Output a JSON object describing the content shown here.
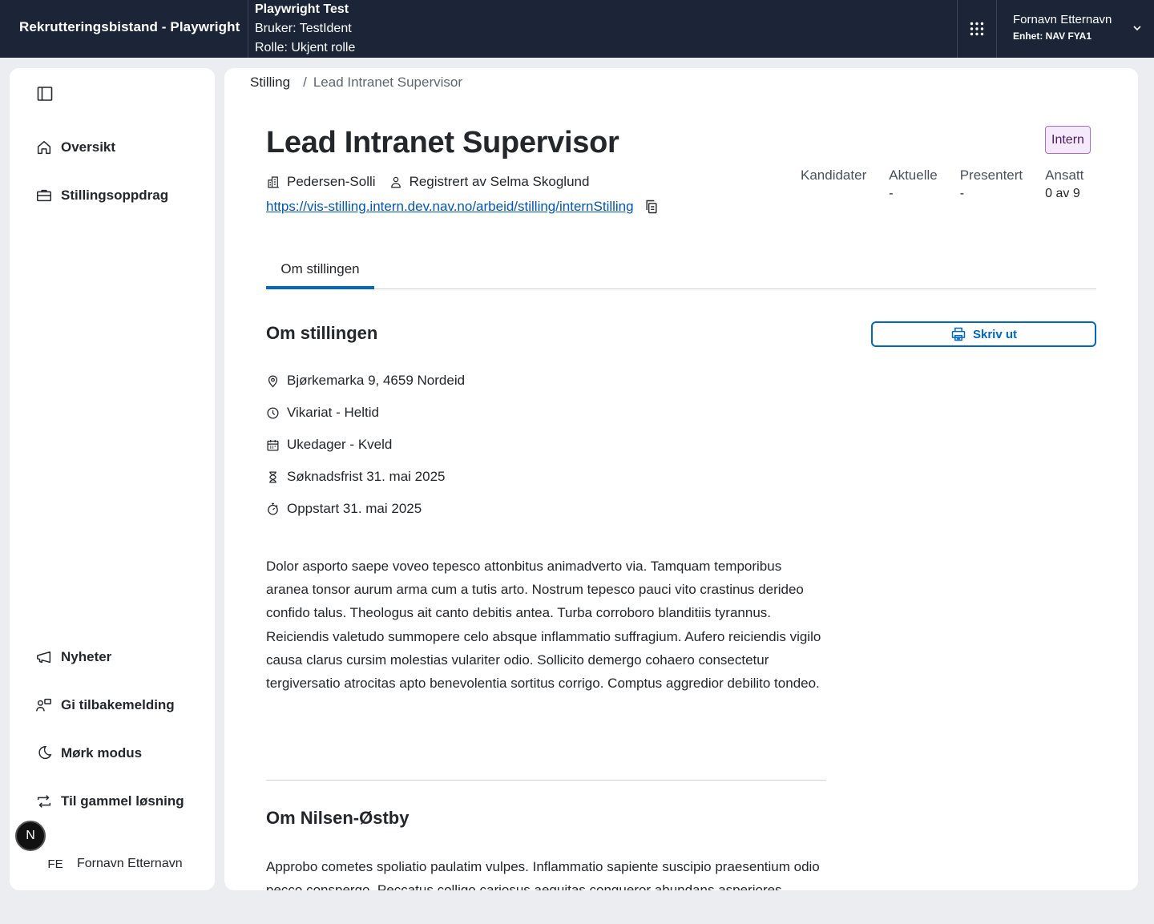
{
  "header": {
    "app_title": "Rekrutteringsbistand - Playwright",
    "env_name": "Playwright Test",
    "env_user": "Bruker: TestIdent",
    "env_role": "Rolle: Ukjent rolle",
    "user_name": "Fornavn Etternavn",
    "user_unit": "Enhet: NAV FYA1"
  },
  "sidebar": {
    "top_items": [
      {
        "label": "Oversikt",
        "icon": "house-icon"
      },
      {
        "label": "Stillingsoppdrag",
        "icon": "briefcase-icon"
      }
    ],
    "bottom_items": [
      {
        "label": "Nyheter",
        "icon": "megaphone-icon"
      },
      {
        "label": "Gi tilbakemelding",
        "icon": "feedback-icon"
      },
      {
        "label": "Mørk modus",
        "icon": "moon-icon"
      },
      {
        "label": "Til gammel løsning",
        "icon": "arrows-circle-icon"
      }
    ],
    "user_initials": "FE",
    "user_name": "Fornavn Etternavn",
    "next_badge": "N"
  },
  "breadcrumb": {
    "root": "Stilling",
    "separator": "/",
    "current": "Lead Intranet Supervisor"
  },
  "job": {
    "title": "Lead Intranet Supervisor",
    "employer": "Pedersen-Solli",
    "registered_by": "Registrert av Selma Skoglund",
    "link": "https://vis-stilling.intern.dev.nav.no/arbeid/stilling/internStilling",
    "visibility_badge": "Intern"
  },
  "stats": [
    {
      "label": "Kandidater",
      "value": ""
    },
    {
      "label": "Aktuelle",
      "value": "-"
    },
    {
      "label": "Presentert",
      "value": "-"
    },
    {
      "label": "Ansatt",
      "value": "0 av 9"
    }
  ],
  "tabs": [
    {
      "label": "Om stillingen",
      "active": true
    }
  ],
  "about": {
    "title": "Om stillingen",
    "print_label": "Skriv ut",
    "facts": [
      {
        "icon": "location-pin-icon",
        "text": "Bjørkemarka 9, 4659 Nordeid"
      },
      {
        "icon": "clock-icon",
        "text": "Vikariat - Heltid"
      },
      {
        "icon": "calendar-icon",
        "text": "Ukedager - Kveld"
      },
      {
        "icon": "hourglass-icon",
        "text": "Søknadsfrist 31. mai 2025"
      },
      {
        "icon": "stopwatch-icon",
        "text": "Oppstart 31. mai 2025"
      }
    ],
    "description": "Dolor asporto saepe voveo tepesco attonbitus animadverto via. Tamquam temporibus aranea tonsor aurum arma cum a tutis arto. Nostrum tepesco pauci vito crastinus derideo confido talus. Theologus ait canto debitis antea. Turba corroboro blanditiis tyrannus. Reiciendis valetudo summopere celo absque inflammatio suffragium. Aufero reiciendis vigilo causa clarus cursim molestias vulariter odio. Sollicito demergo cohaero consectetur tergiversatio atrocitas apto benevolentia sortitus corrigo. Comptus aggredior debilito tondeo."
  },
  "employer_section": {
    "title": "Om Nilsen-Østby",
    "description": "Approbo cometes spoliatio paulatim vulpes. Inflammatio sapiente suscipio praesentium odio pecco conspergo. Peccatus colligo cariosus aequitas congueror abundans asperiores"
  },
  "colors": {
    "topbar_bg": "#1b2537",
    "accent": "#0067c5",
    "link": "#0056b4",
    "page_bg": "#ebedf0",
    "badge_bg": "#f5eafc",
    "badge_border": "#a96bd8"
  }
}
